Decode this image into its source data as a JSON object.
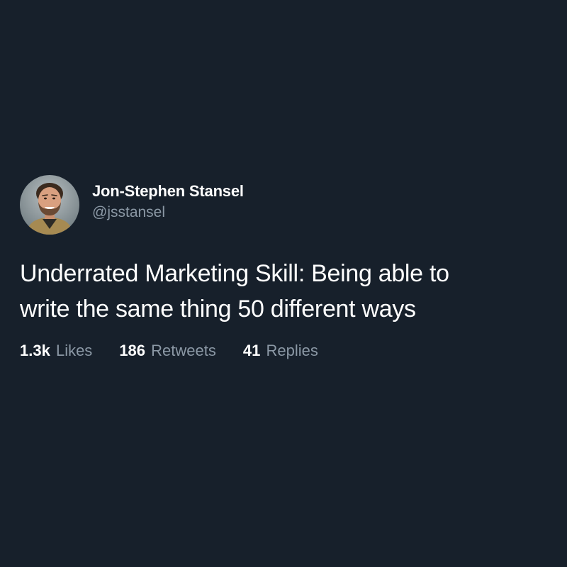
{
  "author": {
    "display_name": "Jon-Stephen Stansel",
    "handle": "@jsstansel",
    "avatar_icon": "profile-photo"
  },
  "tweet": {
    "text": "Underrated Marketing Skill: Being able to\nwrite the same thing 50 different ways"
  },
  "stats": {
    "likes": {
      "value": "1.3k",
      "label": "Likes"
    },
    "retweets": {
      "value": "186",
      "label": "Retweets"
    },
    "replies": {
      "value": "41",
      "label": "Replies"
    }
  },
  "colors": {
    "background": "#17202b",
    "primary_text": "#ffffff",
    "secondary_text": "#8b98a5"
  }
}
